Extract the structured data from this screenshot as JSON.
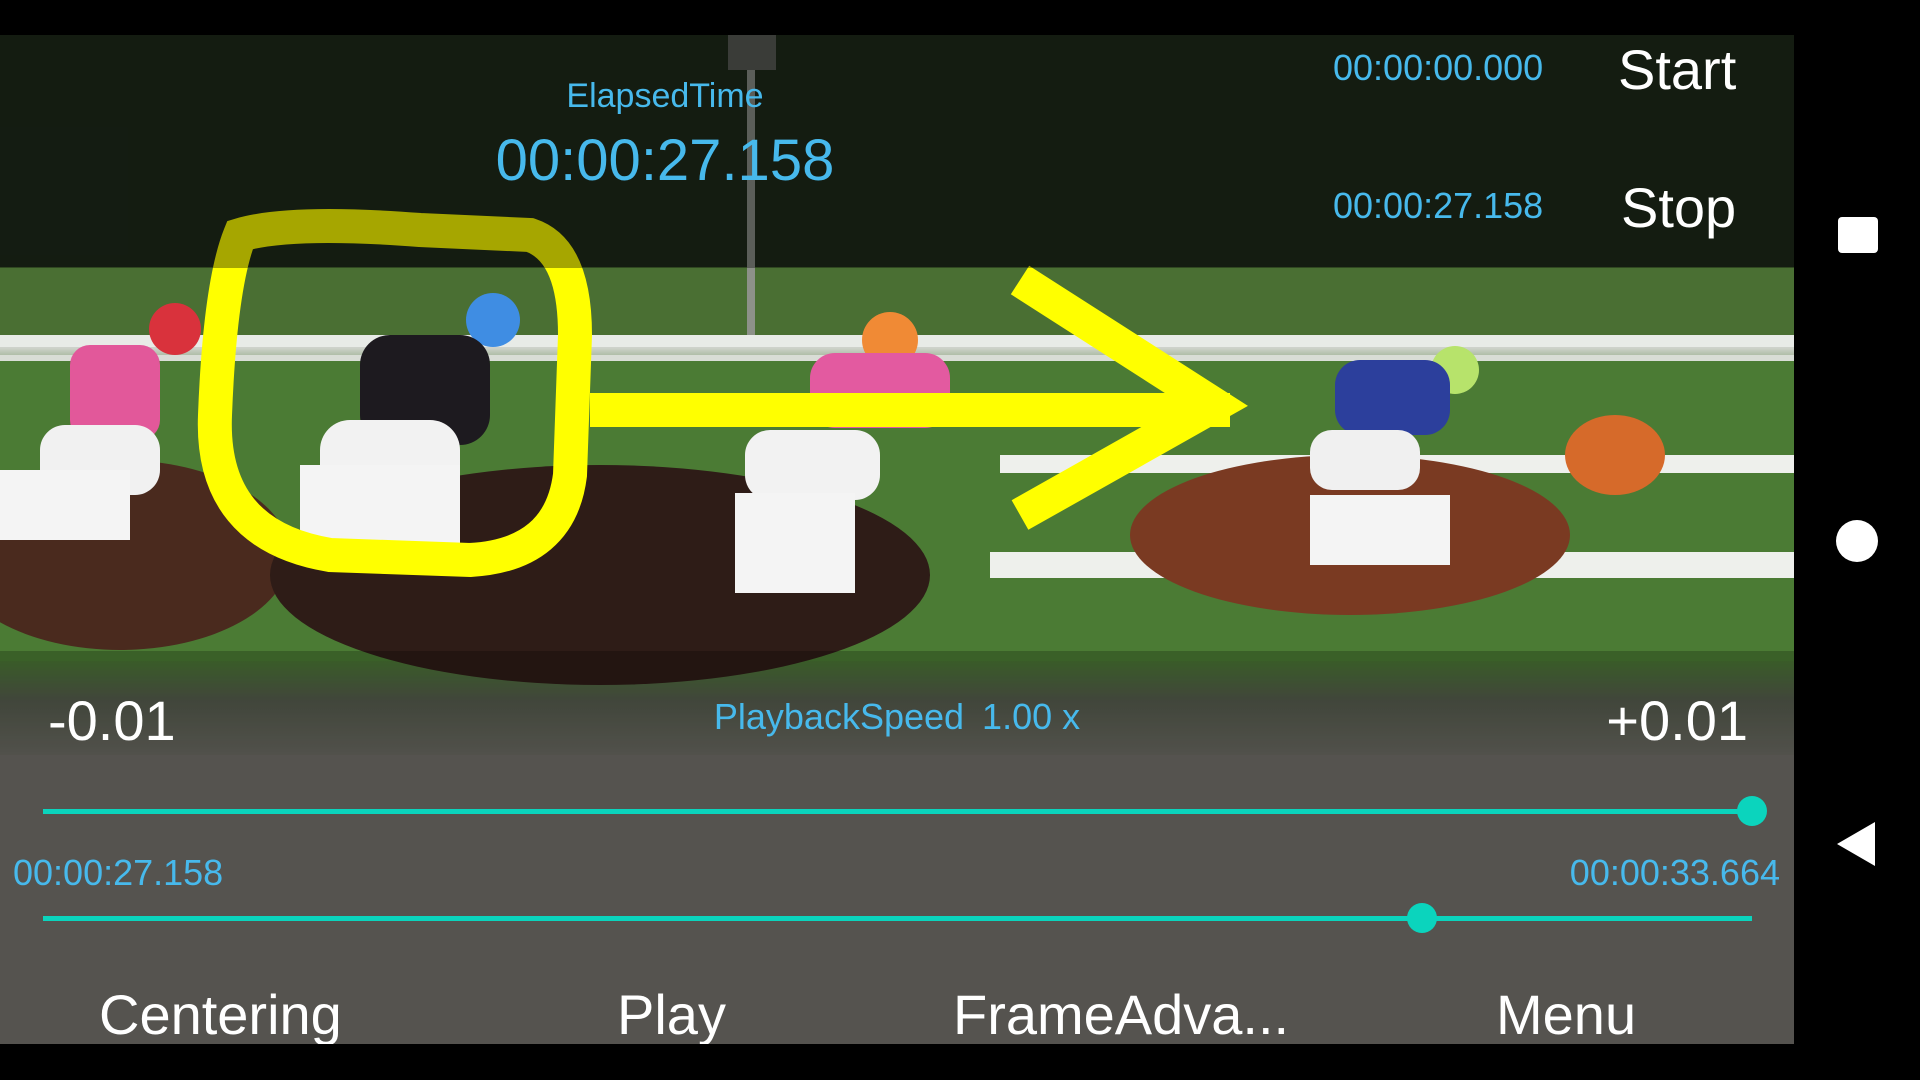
{
  "colors": {
    "accent_blue": "#47b9ec",
    "slider_teal": "#0bd4bd",
    "annotation_yellow": "#ffff00",
    "text_white": "#ffffff"
  },
  "elapsed": {
    "label": "ElapsedTime",
    "value": "00:00:27.158"
  },
  "markers": {
    "start_time": "00:00:00.000",
    "start_label": "Start",
    "stop_time": "00:00:27.158",
    "stop_label": "Stop"
  },
  "speed_controls": {
    "decrement_label": "-0.01",
    "increment_label": "+0.01",
    "speed_label": "PlaybackSpeed",
    "speed_value": "1.00 x",
    "speed_slider_fraction": 1.0
  },
  "timeline": {
    "current_time": "00:00:27.158",
    "total_time": "00:00:33.664",
    "position_fraction": 0.807
  },
  "bottom_buttons": {
    "centering": "Centering",
    "play": "Play",
    "frame_advance": "FrameAdva...",
    "menu": "Menu"
  },
  "video": {
    "annotations": [
      "yellow-circle-around-jockey",
      "yellow-arrow-right"
    ]
  },
  "nav": {
    "recent_icon": "square-recents-icon",
    "home_icon": "circle-home-icon",
    "back_icon": "triangle-back-icon"
  }
}
